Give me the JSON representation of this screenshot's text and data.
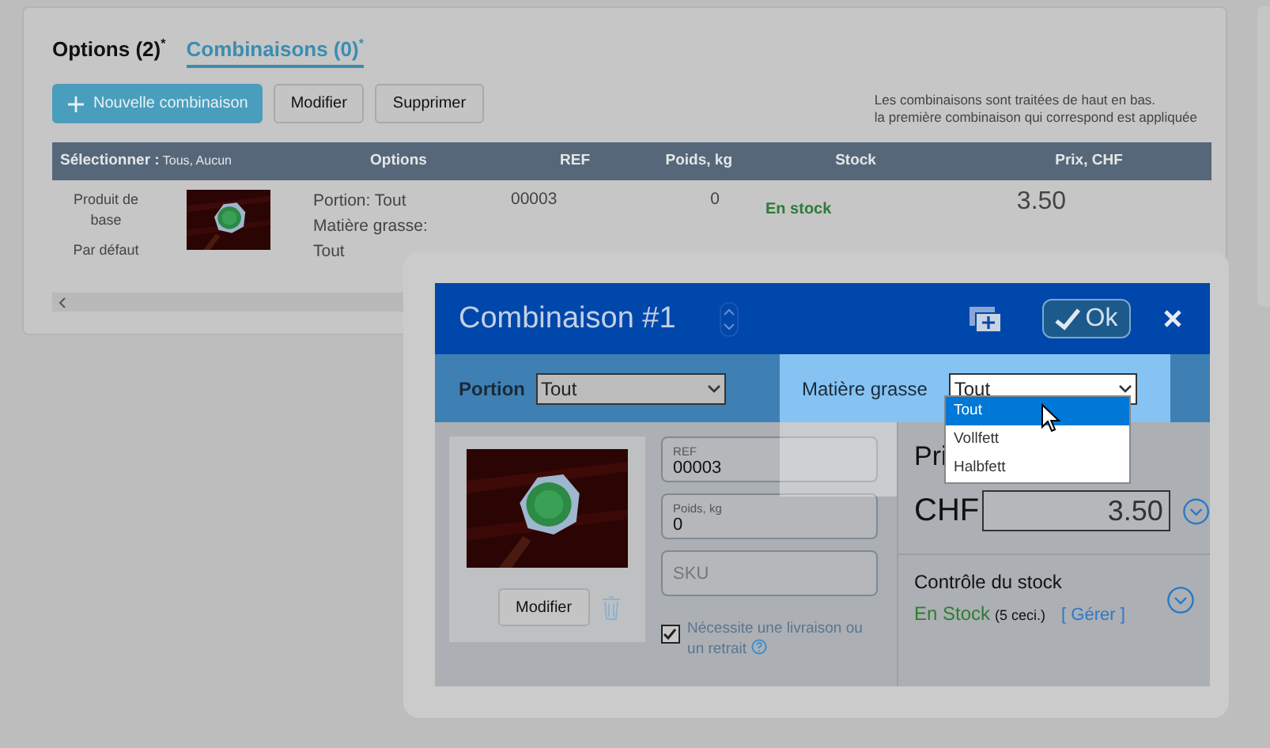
{
  "tabs": [
    {
      "label": "Options (2)$^{*}$",
      "selected": false
    },
    {
      "label": "Combinaisons (0)$^{*}$",
      "selected": true
    }
  ],
  "toolbar": {
    "buttons": [
      {
        "label": "Nouvelle combinaison",
        "kind": "primary"
      },
      {
        "label": "Modifier",
        "kind": "default"
      },
      {
        "label": "Supprimer",
        "kind": "default"
      }
    ],
    "note": [
      "Les combinaisons sont traitées de haut en bas.",
      "la première combinaison qui correspond est appliquée"
    ]
  },
  "table": {
    "select_label": "Sélectionner :",
    "select_options": "Tous, Aucun",
    "columns": [
      "Options",
      "REF",
      "Poids, kg",
      "Stock",
      "Prix, CHF"
    ],
    "rows": [
      {
        "label": "Produit de base",
        "sublabel": "Par défaut",
        "options": "Portion: Tout Matière grasse: Tout",
        "ref": "00003",
        "weight": "0",
        "stock": "En stock",
        "price": "3.50"
      }
    ]
  },
  "dialog": {
    "title": "Combinaison #1",
    "ok": "Ok",
    "filters": [
      {
        "label": "Portion",
        "value": "Tout",
        "highlighted": false
      },
      {
        "label": "Matière grasse",
        "value": "Tout",
        "highlighted": true,
        "options": [
          {
            "label": "Tout",
            "selected": true
          },
          {
            "label": "Vollfett",
            "selected": false
          },
          {
            "label": "Halbfett",
            "selected": false
          }
        ]
      }
    ],
    "image_button": "Modifier",
    "fields": [
      {
        "label": "REF",
        "value": "00003"
      },
      {
        "label": "Poids, kg",
        "value": "0"
      },
      {
        "placeholder": "SKU"
      }
    ],
    "shipping": {
      "label": "Nécessite une livraison ou un retrait",
      "checked": true
    },
    "price": {
      "title": "Pri",
      "currency": "CHF",
      "value": "3.50"
    },
    "stock": {
      "title": "Contrôle du stock",
      "status": "En Stock",
      "count": "(5 ceci.)",
      "link": "[ Gérer ]"
    }
  }
}
